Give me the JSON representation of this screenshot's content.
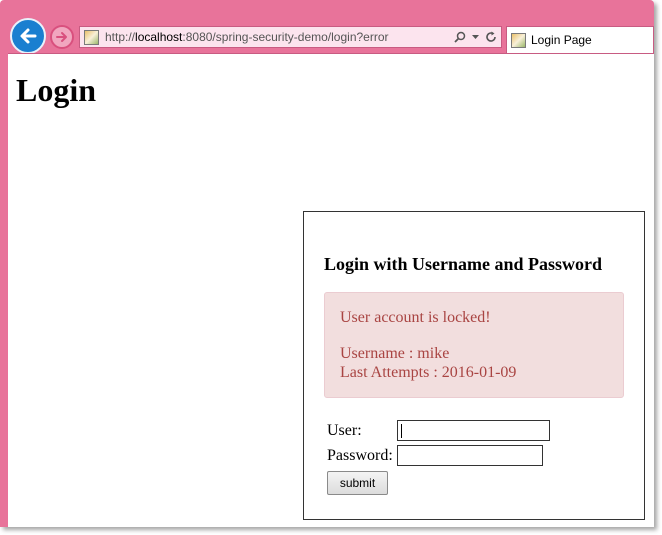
{
  "browser": {
    "url_prefix": "http://",
    "url_host": "localhost",
    "url_rest": ":8080/spring-security-demo/login?error",
    "tab_title": "Login Page"
  },
  "page": {
    "heading": "Login",
    "box_title": "Login with Username and Password",
    "alert": {
      "message": "User account is locked!",
      "username_line": "Username : mike",
      "attempts_line": "Last Attempts : 2016-01-09"
    },
    "form": {
      "user_label": "User:",
      "user_value": "",
      "password_label": "Password:",
      "password_value": "",
      "submit_label": "submit"
    }
  },
  "colors": {
    "frame": "#e8739a",
    "alert_bg": "#f2dede",
    "alert_text": "#a94442",
    "back_button": "#1a7fd0"
  }
}
